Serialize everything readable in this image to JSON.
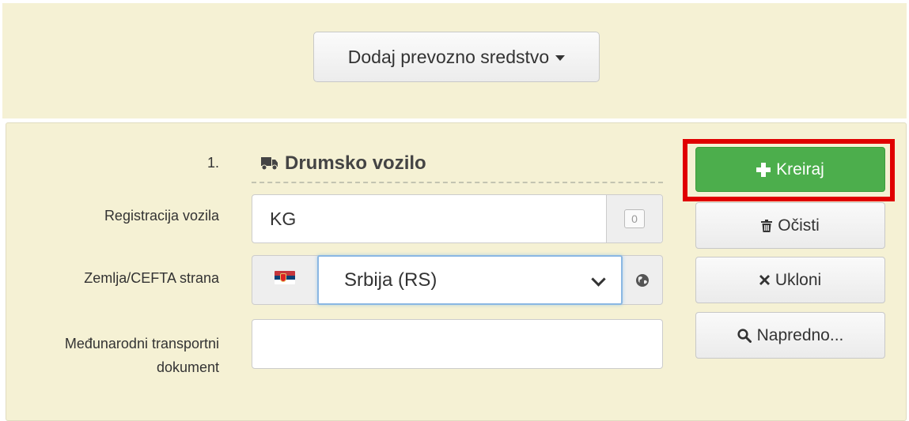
{
  "header": {
    "add_transport_label": "Dodaj prevozno sredstvo"
  },
  "vehicle": {
    "index_label": "1.",
    "section_title": "Drumsko vozilo",
    "registration_label": "Registracija vozila",
    "registration_value": "KG",
    "registration_counter": "0",
    "country_label": "Zemlja/CEFTA strana",
    "country_value": "Srbija (RS)",
    "document_label": "Međunarodni transportni dokument",
    "document_value": ""
  },
  "actions": {
    "create_label": "Kreiraj",
    "clear_label": "Očisti",
    "remove_label": "Ukloni",
    "advanced_label": "Napredno..."
  },
  "colors": {
    "panel_bg": "#f5f1d4",
    "create_green": "#4cae4c",
    "highlight_red": "#e00000",
    "select_focus_blue": "#8ab7e3"
  },
  "icons": {
    "dropdown": "caret-down-icon",
    "section": "truck-icon",
    "country_flag": "serbia-flag-icon",
    "country_globe": "globe-icon",
    "create": "plus-icon",
    "clear": "trash-icon",
    "remove": "close-icon",
    "advanced": "search-icon"
  }
}
